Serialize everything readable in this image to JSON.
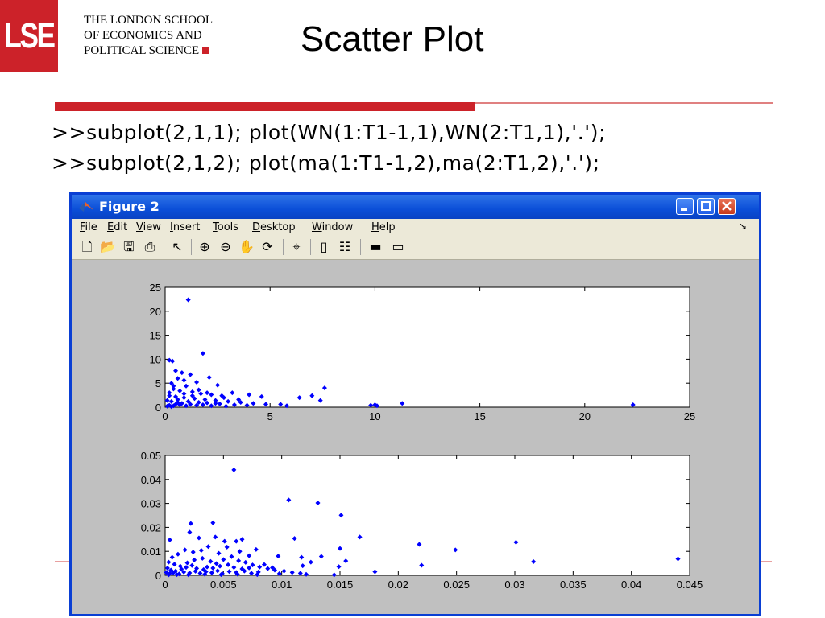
{
  "header": {
    "logo": "LSE",
    "school_lines": [
      "THE LONDON SCHOOL",
      "OF ECONOMICS AND",
      "POLITICAL SCIENCE"
    ],
    "slide_title": "Scatter Plot"
  },
  "code": {
    "line1": ">>subplot(2,1,1); plot(WN(1:T1-1,1),WN(2:T1,1),'.');",
    "line2": ">>subplot(2,1,2); plot(ma(1:T1-1,2),ma(2:T1,2),'.');"
  },
  "window": {
    "title": "Figure 2",
    "menu": [
      "File",
      "Edit",
      "View",
      "Insert",
      "Tools",
      "Desktop",
      "Window",
      "Help"
    ],
    "toolbar_icons": [
      "new-icon",
      "open-icon",
      "save-icon",
      "print-icon",
      "pointer-icon",
      "zoom-in-icon",
      "zoom-out-icon",
      "pan-icon",
      "rotate-icon",
      "datacursor-icon",
      "colorbar-icon",
      "legend-icon",
      "hide-plot-icon",
      "show-plot-icon"
    ]
  },
  "chart_data": [
    {
      "type": "scatter",
      "title": "",
      "xlabel": "",
      "ylabel": "",
      "xlim": [
        0,
        25
      ],
      "ylim": [
        0,
        25
      ],
      "xticks": [
        "0",
        "5",
        "10",
        "15",
        "20",
        "25"
      ],
      "yticks": [
        "0",
        "5",
        "10",
        "15",
        "20",
        "25"
      ],
      "color": "#0000ff",
      "points": [
        [
          1.1,
          22.4
        ],
        [
          0.2,
          9.8
        ],
        [
          0.35,
          9.6
        ],
        [
          1.8,
          11.2
        ],
        [
          0.8,
          7.2
        ],
        [
          0.5,
          7.6
        ],
        [
          1.2,
          6.8
        ],
        [
          2.1,
          6.2
        ],
        [
          0.6,
          6.0
        ],
        [
          0.9,
          5.6
        ],
        [
          1.5,
          5.2
        ],
        [
          2.5,
          4.6
        ],
        [
          0.3,
          5.0
        ],
        [
          1.0,
          4.4
        ],
        [
          7.6,
          4.0
        ],
        [
          6.4,
          2.0
        ],
        [
          7.0,
          2.4
        ],
        [
          7.4,
          1.4
        ],
        [
          3.2,
          3.0
        ],
        [
          4.0,
          2.6
        ],
        [
          4.6,
          2.2
        ],
        [
          0.4,
          3.8
        ],
        [
          0.7,
          3.4
        ],
        [
          1.3,
          3.2
        ],
        [
          1.7,
          2.8
        ],
        [
          2.2,
          2.6
        ],
        [
          2.8,
          2.0
        ],
        [
          3.5,
          1.6
        ],
        [
          0.2,
          2.4
        ],
        [
          0.5,
          2.2
        ],
        [
          0.9,
          2.0
        ],
        [
          1.4,
          1.8
        ],
        [
          1.9,
          1.6
        ],
        [
          2.4,
          1.4
        ],
        [
          3.0,
          1.2
        ],
        [
          3.6,
          1.0
        ],
        [
          4.2,
          0.8
        ],
        [
          4.8,
          0.6
        ],
        [
          5.5,
          0.6
        ],
        [
          0.1,
          1.4
        ],
        [
          0.3,
          1.2
        ],
        [
          0.6,
          1.0
        ],
        [
          0.8,
          0.8
        ],
        [
          1.1,
          1.2
        ],
        [
          1.6,
          1.0
        ],
        [
          2.0,
          0.9
        ],
        [
          2.6,
          0.7
        ],
        [
          3.3,
          0.5
        ],
        [
          3.9,
          0.4
        ],
        [
          0.2,
          0.4
        ],
        [
          0.4,
          0.3
        ],
        [
          0.7,
          0.5
        ],
        [
          1.0,
          0.3
        ],
        [
          1.5,
          0.4
        ],
        [
          2.2,
          0.3
        ],
        [
          2.9,
          0.2
        ],
        [
          0.1,
          0.2
        ],
        [
          0.3,
          0.1
        ],
        [
          0.5,
          0.6
        ],
        [
          1.2,
          0.6
        ],
        [
          1.8,
          0.5
        ],
        [
          2.4,
          0.8
        ],
        [
          0.6,
          1.6
        ],
        [
          0.9,
          2.8
        ],
        [
          1.3,
          2.4
        ],
        [
          0.4,
          4.4
        ],
        [
          0.2,
          3.0
        ],
        [
          1.6,
          3.6
        ],
        [
          2.0,
          3.0
        ],
        [
          2.7,
          2.4
        ],
        [
          5.8,
          0.3
        ],
        [
          9.8,
          0.4
        ],
        [
          10.1,
          0.3
        ],
        [
          10.0,
          0.5
        ],
        [
          11.3,
          0.8
        ],
        [
          22.3,
          0.5
        ]
      ]
    },
    {
      "type": "scatter",
      "title": "",
      "xlabel": "",
      "ylabel": "",
      "xlim": [
        0,
        0.045
      ],
      "ylim": [
        0,
        0.05
      ],
      "xticks": [
        "0",
        "0.005",
        "0.01",
        "0.015",
        "0.02",
        "0.025",
        "0.03",
        "0.035",
        "0.04",
        "0.045"
      ],
      "yticks": [
        "0",
        "0.01",
        "0.02",
        "0.03",
        "0.04",
        "0.05"
      ],
      "color": "#0000ff",
      "points": [
        [
          0.0059,
          0.044
        ],
        [
          0.0106,
          0.0314
        ],
        [
          0.0131,
          0.0302
        ],
        [
          0.0151,
          0.0251
        ],
        [
          0.0022,
          0.0216
        ],
        [
          0.0041,
          0.0219
        ],
        [
          0.0004,
          0.0148
        ],
        [
          0.0167,
          0.016
        ],
        [
          0.0111,
          0.0154
        ],
        [
          0.0218,
          0.0129
        ],
        [
          0.0249,
          0.0106
        ],
        [
          0.0301,
          0.0138
        ],
        [
          0.0316,
          0.0057
        ],
        [
          0.044,
          0.0069
        ],
        [
          0.022,
          0.0042
        ],
        [
          0.0021,
          0.018
        ],
        [
          0.0029,
          0.0156
        ],
        [
          0.0043,
          0.016
        ],
        [
          0.0051,
          0.0142
        ],
        [
          0.0061,
          0.0142
        ],
        [
          0.0066,
          0.015
        ],
        [
          0.0078,
          0.0108
        ],
        [
          0.0097,
          0.008
        ],
        [
          0.0117,
          0.0075
        ],
        [
          0.0134,
          0.0079
        ],
        [
          0.015,
          0.0112
        ],
        [
          0.0155,
          0.006
        ],
        [
          0.0149,
          0.0036
        ],
        [
          0.0125,
          0.0055
        ],
        [
          0.0092,
          0.0032
        ],
        [
          0.0085,
          0.0045
        ],
        [
          0.0072,
          0.0082
        ],
        [
          0.0064,
          0.01
        ],
        [
          0.0053,
          0.0118
        ],
        [
          0.0046,
          0.0092
        ],
        [
          0.0037,
          0.012
        ],
        [
          0.0031,
          0.0104
        ],
        [
          0.0024,
          0.0097
        ],
        [
          0.0017,
          0.0106
        ],
        [
          0.0011,
          0.0088
        ],
        [
          0.0006,
          0.0075
        ],
        [
          0.0003,
          0.0055
        ],
        [
          0.0008,
          0.0046
        ],
        [
          0.0013,
          0.0038
        ],
        [
          0.0019,
          0.0052
        ],
        [
          0.0025,
          0.0064
        ],
        [
          0.0032,
          0.0071
        ],
        [
          0.0039,
          0.0058
        ],
        [
          0.0044,
          0.0049
        ],
        [
          0.005,
          0.0066
        ],
        [
          0.0057,
          0.0078
        ],
        [
          0.0063,
          0.0061
        ],
        [
          0.0069,
          0.0054
        ],
        [
          0.0075,
          0.0043
        ],
        [
          0.0081,
          0.0035
        ],
        [
          0.0088,
          0.0028
        ],
        [
          0.0094,
          0.0022
        ],
        [
          0.0102,
          0.0018
        ],
        [
          0.0109,
          0.0012
        ],
        [
          0.0116,
          0.0009
        ],
        [
          0.0002,
          0.003
        ],
        [
          0.0005,
          0.0022
        ],
        [
          0.0009,
          0.0018
        ],
        [
          0.0014,
          0.0026
        ],
        [
          0.0018,
          0.0033
        ],
        [
          0.0023,
          0.0041
        ],
        [
          0.0027,
          0.0029
        ],
        [
          0.0033,
          0.0024
        ],
        [
          0.0036,
          0.0035
        ],
        [
          0.0041,
          0.003
        ],
        [
          0.0047,
          0.0038
        ],
        [
          0.0054,
          0.0044
        ],
        [
          0.0059,
          0.0033
        ],
        [
          0.0066,
          0.0027
        ],
        [
          0.0072,
          0.0031
        ],
        [
          0.0001,
          0.0012
        ],
        [
          0.0004,
          0.0008
        ],
        [
          0.0007,
          0.0011
        ],
        [
          0.0012,
          0.0006
        ],
        [
          0.0016,
          0.0014
        ],
        [
          0.0021,
          0.001
        ],
        [
          0.0026,
          0.0017
        ],
        [
          0.003,
          0.0009
        ],
        [
          0.0035,
          0.0015
        ],
        [
          0.004,
          0.0011
        ],
        [
          0.0045,
          0.0019
        ],
        [
          0.0049,
          0.0007
        ],
        [
          0.0055,
          0.0016
        ],
        [
          0.0061,
          0.0012
        ],
        [
          0.0068,
          0.0018
        ],
        [
          0.0074,
          0.0009
        ],
        [
          0.008,
          0.0014
        ],
        [
          0.0003,
          0.0002
        ],
        [
          0.001,
          0.0003
        ],
        [
          0.002,
          0.0002
        ],
        [
          0.0034,
          0.0004
        ],
        [
          0.0048,
          0.0003
        ],
        [
          0.0062,
          0.0005
        ],
        [
          0.0079,
          0.0003
        ],
        [
          0.0098,
          0.0007
        ],
        [
          0.0121,
          0.0004
        ],
        [
          0.0145,
          0.0002
        ],
        [
          0.018,
          0.0015
        ],
        [
          0.0118,
          0.004
        ]
      ]
    }
  ]
}
